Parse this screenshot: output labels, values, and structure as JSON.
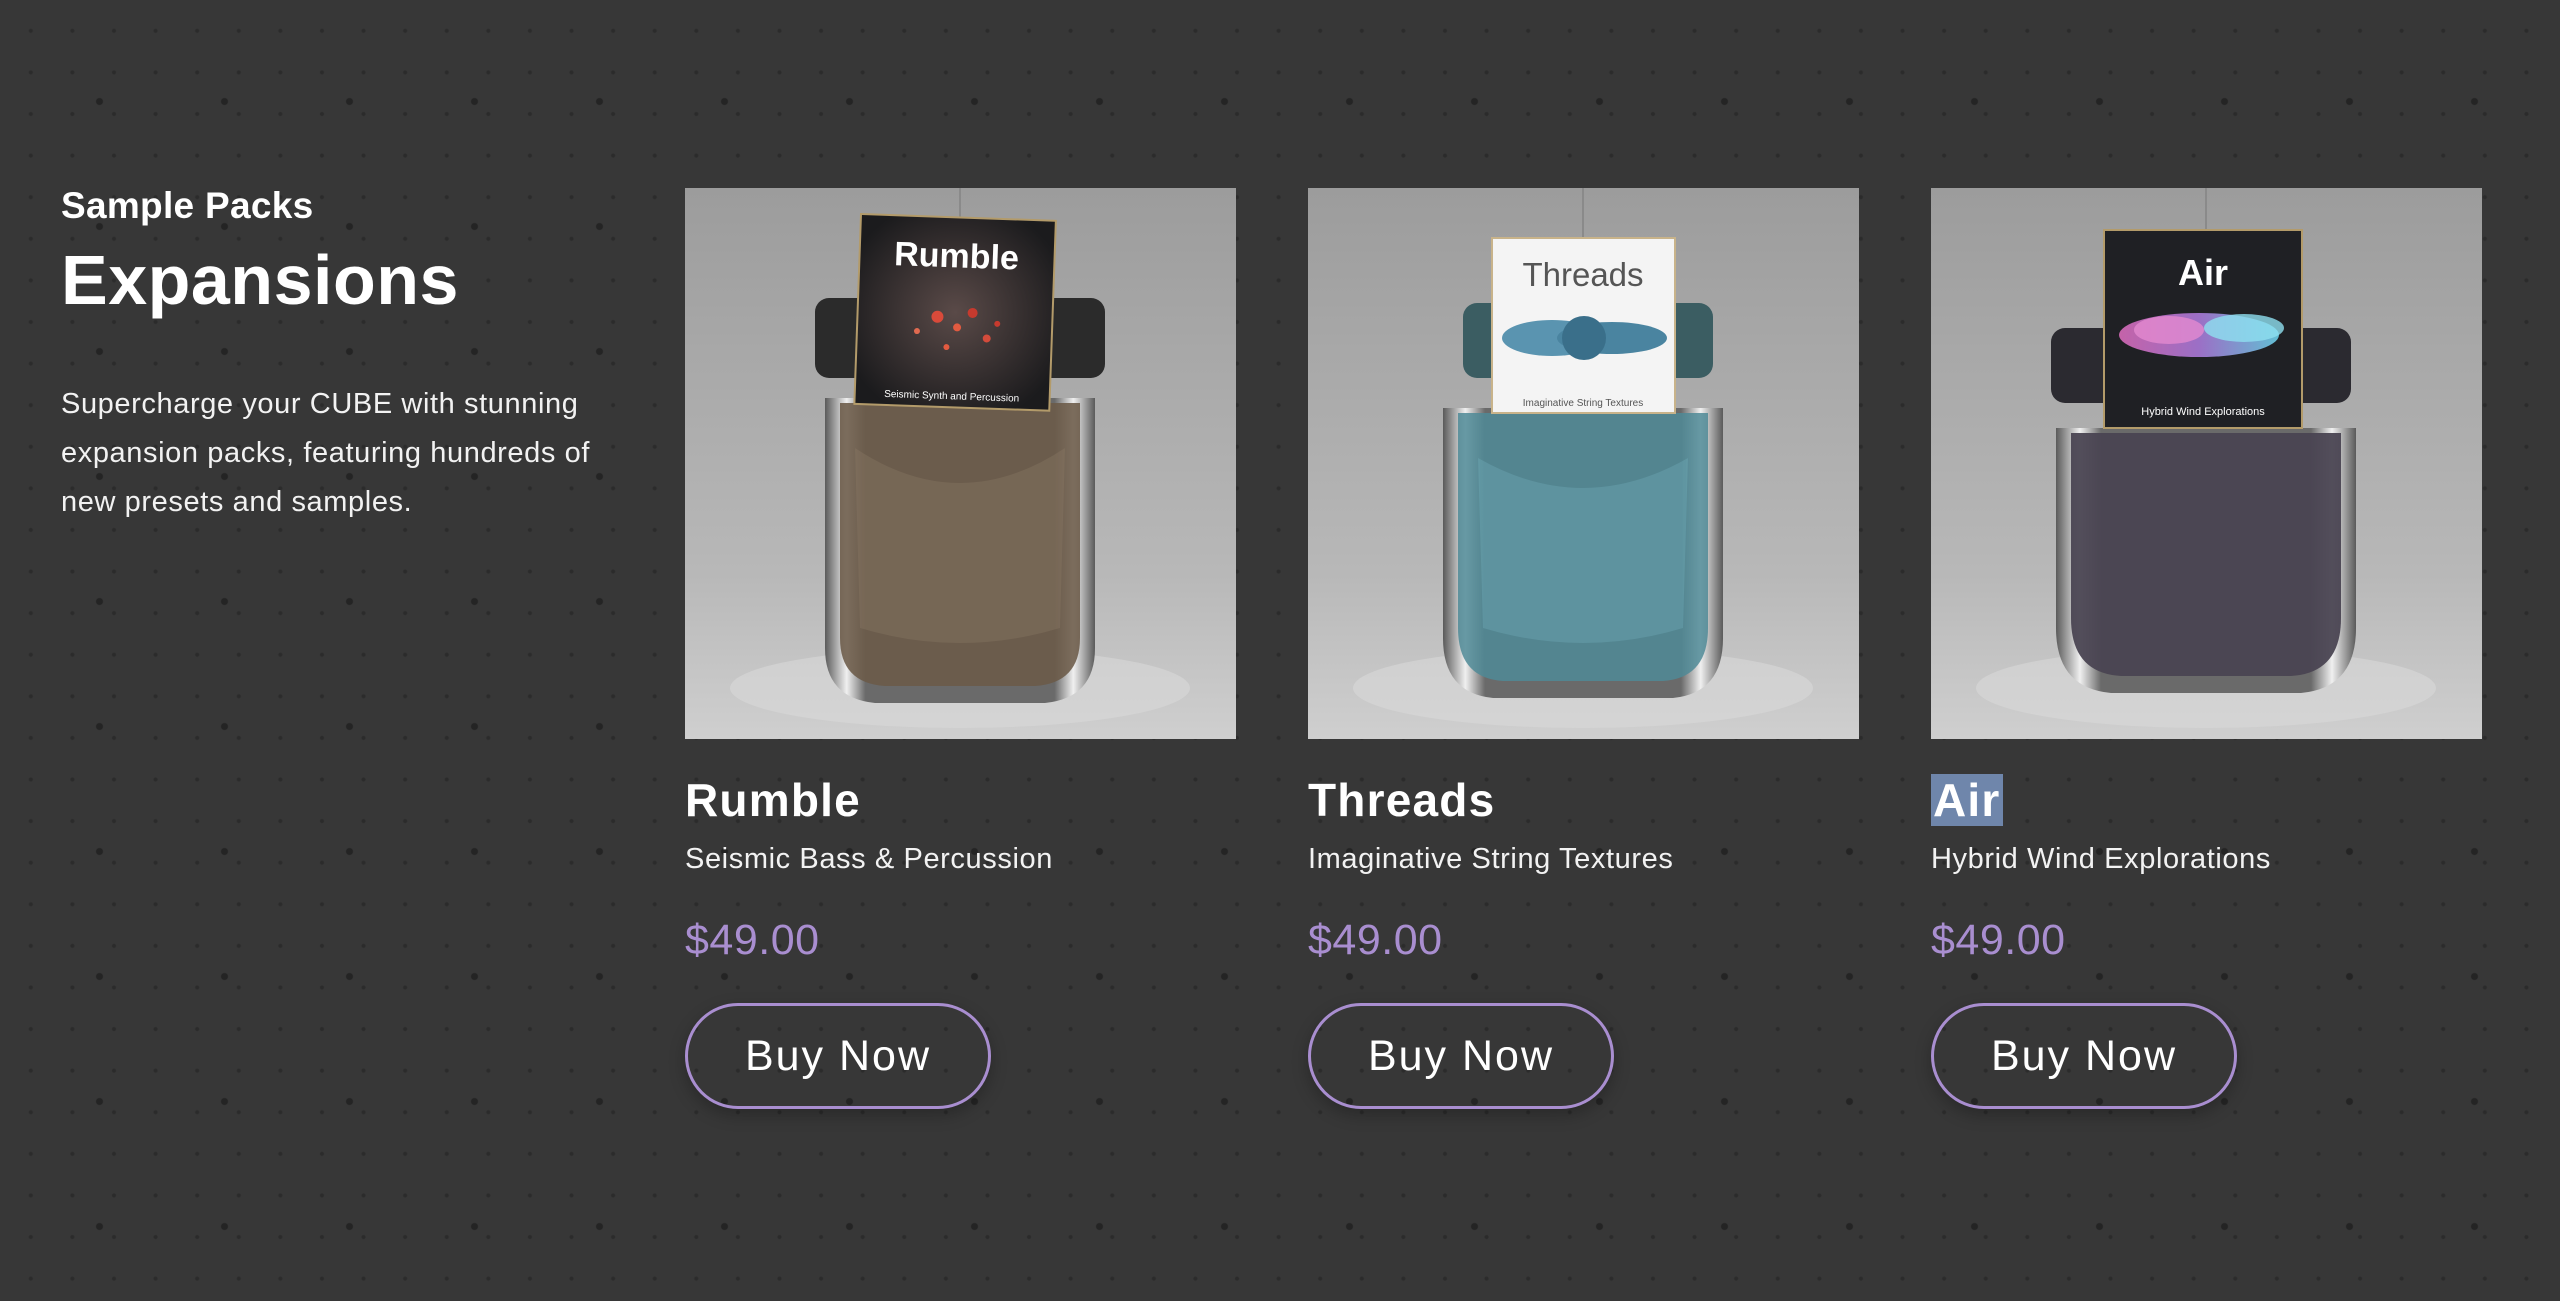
{
  "intro": {
    "eyebrow": "Sample Packs",
    "heading": "Expansions",
    "description": "Supercharge your CUBE with stunning expansion packs, featuring hundreds of new presets and samples."
  },
  "products": [
    {
      "name": "Rumble",
      "cover_title": "Rumble",
      "cover_subtitle": "Seismic Synth and Percussion",
      "subtitle": "Seismic Bass & Percussion",
      "price": "$49.00",
      "button": "Buy Now",
      "glass_color": "#6b5a48"
    },
    {
      "name": "Threads",
      "cover_title": "Threads",
      "cover_subtitle": "Imaginative String Textures",
      "subtitle": "Imaginative String Textures",
      "price": "$49.00",
      "button": "Buy Now",
      "glass_color": "#4f8a96"
    },
    {
      "name": "Air",
      "cover_title": "Air",
      "cover_subtitle": "Hybrid Wind Explorations",
      "subtitle": "Hybrid Wind Explorations",
      "price": "$49.00",
      "button": "Buy Now",
      "glass_color": "#4a4452",
      "title_selected": true
    }
  ],
  "colors": {
    "background": "#373737",
    "accent": "#a98ed0",
    "selection": "#6f86ab"
  }
}
